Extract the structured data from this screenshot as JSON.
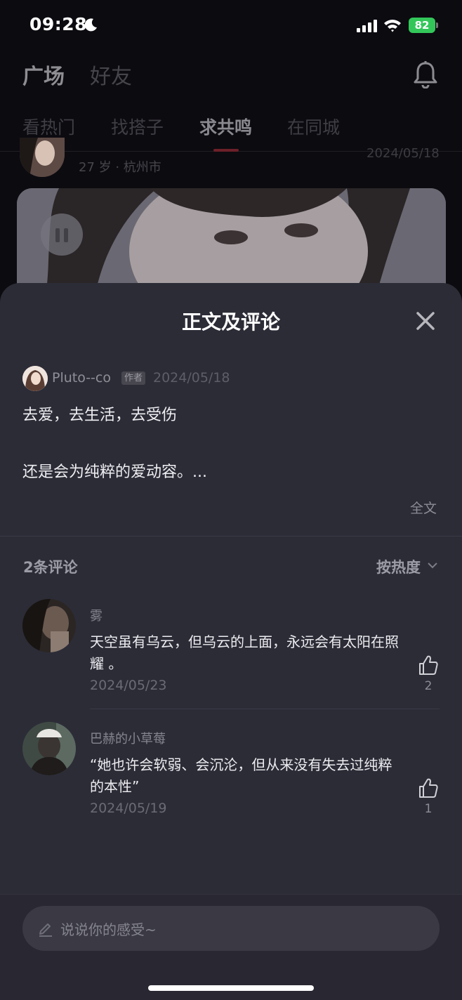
{
  "status_bar": {
    "time": "09:28",
    "battery": "82"
  },
  "header": {
    "tabs": [
      {
        "label": "广场",
        "active": true
      },
      {
        "label": "好友",
        "active": false
      }
    ],
    "sub_tabs": [
      {
        "label": "看热门"
      },
      {
        "label": "找搭子"
      },
      {
        "label": "求共鸣",
        "active": true
      },
      {
        "label": "在同城"
      }
    ]
  },
  "feed": {
    "meta": "27 岁 · 杭州市",
    "date": "2024/05/18"
  },
  "sheet": {
    "title": "正文及评论",
    "author": {
      "name": "Pluto--co",
      "badge": "作者",
      "date": "2024/05/18"
    },
    "post": {
      "line1": "去爱，去生活，去受伤",
      "line2": "还是会为纯粹的爱动容。..."
    },
    "full_text_label": "全文",
    "comments_count": "2条评论",
    "sort_label": "按热度",
    "comments": [
      {
        "name": "雾",
        "text": "天空虽有乌云，但乌云的上面，永远会有太阳在照耀 。",
        "date": "2024/05/23",
        "likes": "2"
      },
      {
        "name": "巴赫的小草莓",
        "text": "“她也许会软弱、会沉沦，但从来没有失去过纯粹的本性”",
        "date": "2024/05/19",
        "likes": "1"
      }
    ],
    "input_placeholder": "说说你的感受~"
  },
  "colors": {
    "sheet_bg": "#2c2c37",
    "accent_underline": "#6d2028",
    "battery_green": "#33c75a"
  },
  "icons": [
    "moon-icon",
    "signal-icon",
    "wifi-icon",
    "battery-icon",
    "bell-icon",
    "pause-icon",
    "close-icon",
    "chevron-down-icon",
    "thumb-up-icon",
    "pen-icon"
  ]
}
